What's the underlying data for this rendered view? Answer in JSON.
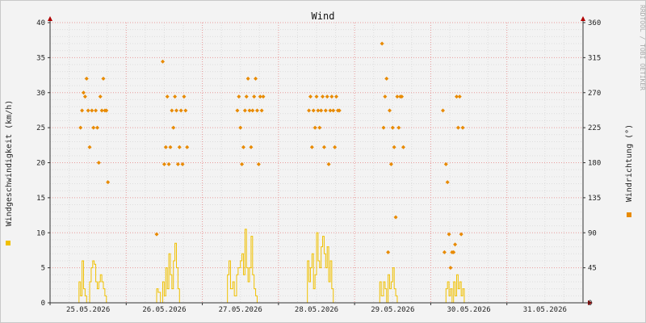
{
  "chart_data": {
    "type": "scatter",
    "title": "Wind",
    "ylabel": "Windgeschwindigkeit (km/h)",
    "y2label": "Windrichtung (°)",
    "watermark": "RRDTOOL / TOBI OETIKER",
    "xticks": [
      "25.05.2026",
      "26.05.2026",
      "27.05.2026",
      "28.05.2026",
      "29.05.2026",
      "30.05.2026",
      "31.05.2026"
    ],
    "yticks": [
      0,
      5,
      10,
      15,
      20,
      25,
      30,
      35,
      40
    ],
    "y2ticks": [
      0,
      45,
      90,
      135,
      180,
      225,
      270,
      315,
      360
    ],
    "ylim": [
      0,
      40
    ],
    "y2lim": [
      0,
      360
    ],
    "xlim_days": [
      0,
      7
    ],
    "grid": true,
    "colors": {
      "speed": "#f0c000",
      "direction": "#e88a00",
      "grid_major": "#e89a9a",
      "grid_minor": "#dddddd",
      "axis": "#b00000"
    },
    "series": [
      {
        "name": "",
        "type": "line",
        "points": [
          [
            0.36,
            0
          ],
          [
            0.38,
            3
          ],
          [
            0.4,
            1
          ],
          [
            0.42,
            6
          ],
          [
            0.44,
            2
          ],
          [
            0.46,
            1
          ],
          [
            0.48,
            0
          ],
          [
            0.52,
            3
          ],
          [
            0.54,
            5
          ],
          [
            0.56,
            6
          ],
          [
            0.58,
            5.5
          ],
          [
            0.6,
            3
          ],
          [
            0.62,
            2
          ],
          [
            0.64,
            3
          ],
          [
            0.66,
            4
          ],
          [
            0.68,
            3
          ],
          [
            0.7,
            2
          ],
          [
            0.72,
            1
          ],
          [
            0.74,
            0
          ],
          [
            1.36,
            0
          ],
          [
            1.4,
            2
          ],
          [
            1.42,
            1.5
          ],
          [
            1.45,
            0
          ],
          [
            1.48,
            3
          ],
          [
            1.5,
            1
          ],
          [
            1.52,
            5
          ],
          [
            1.54,
            2
          ],
          [
            1.56,
            7
          ],
          [
            1.58,
            4
          ],
          [
            1.6,
            2
          ],
          [
            1.62,
            6
          ],
          [
            1.64,
            8.5
          ],
          [
            1.66,
            5
          ],
          [
            1.68,
            2
          ],
          [
            1.7,
            0
          ],
          [
            2.3,
            0
          ],
          [
            2.33,
            4
          ],
          [
            2.35,
            6
          ],
          [
            2.37,
            2
          ],
          [
            2.4,
            3
          ],
          [
            2.42,
            1
          ],
          [
            2.45,
            4
          ],
          [
            2.47,
            5
          ],
          [
            2.5,
            6
          ],
          [
            2.52,
            7
          ],
          [
            2.54,
            4
          ],
          [
            2.56,
            10.5
          ],
          [
            2.58,
            5
          ],
          [
            2.6,
            3
          ],
          [
            2.62,
            5
          ],
          [
            2.64,
            9.5
          ],
          [
            2.66,
            4
          ],
          [
            2.68,
            2
          ],
          [
            2.7,
            1
          ],
          [
            2.72,
            0
          ],
          [
            3.36,
            0
          ],
          [
            3.38,
            6
          ],
          [
            3.4,
            3
          ],
          [
            3.42,
            5
          ],
          [
            3.44,
            7
          ],
          [
            3.46,
            2
          ],
          [
            3.48,
            4
          ],
          [
            3.5,
            10
          ],
          [
            3.52,
            6
          ],
          [
            3.54,
            5
          ],
          [
            3.56,
            8
          ],
          [
            3.58,
            9.5
          ],
          [
            3.6,
            7
          ],
          [
            3.62,
            5
          ],
          [
            3.64,
            8
          ],
          [
            3.66,
            3
          ],
          [
            3.68,
            6
          ],
          [
            3.7,
            2
          ],
          [
            3.72,
            0
          ],
          [
            4.3,
            0
          ],
          [
            4.33,
            3
          ],
          [
            4.35,
            1
          ],
          [
            4.38,
            3
          ],
          [
            4.4,
            2
          ],
          [
            4.42,
            0
          ],
          [
            4.44,
            4
          ],
          [
            4.46,
            2
          ],
          [
            4.48,
            3
          ],
          [
            4.5,
            5
          ],
          [
            4.52,
            2
          ],
          [
            4.54,
            1
          ],
          [
            4.56,
            0
          ],
          [
            5.18,
            0
          ],
          [
            5.2,
            2
          ],
          [
            5.22,
            3
          ],
          [
            5.24,
            1
          ],
          [
            5.26,
            2
          ],
          [
            5.28,
            0
          ],
          [
            5.3,
            3
          ],
          [
            5.32,
            1
          ],
          [
            5.34,
            4
          ],
          [
            5.36,
            2
          ],
          [
            5.38,
            3
          ],
          [
            5.4,
            1
          ],
          [
            5.42,
            2
          ],
          [
            5.44,
            0
          ]
        ]
      },
      {
        "name": "",
        "type": "scatter",
        "points": [
          [
            0.4,
            225
          ],
          [
            0.42,
            247
          ],
          [
            0.44,
            270
          ],
          [
            0.46,
            265
          ],
          [
            0.48,
            288
          ],
          [
            0.5,
            247
          ],
          [
            0.52,
            200
          ],
          [
            0.55,
            247
          ],
          [
            0.57,
            225
          ],
          [
            0.6,
            247
          ],
          [
            0.62,
            225
          ],
          [
            0.64,
            180
          ],
          [
            0.66,
            265
          ],
          [
            0.68,
            247
          ],
          [
            0.7,
            288
          ],
          [
            0.72,
            247
          ],
          [
            0.74,
            247
          ],
          [
            0.76,
            155
          ],
          [
            1.4,
            88
          ],
          [
            1.48,
            310
          ],
          [
            1.5,
            178
          ],
          [
            1.52,
            200
          ],
          [
            1.54,
            265
          ],
          [
            1.56,
            178
          ],
          [
            1.58,
            200
          ],
          [
            1.6,
            247
          ],
          [
            1.62,
            225
          ],
          [
            1.64,
            265
          ],
          [
            1.66,
            247
          ],
          [
            1.68,
            178
          ],
          [
            1.7,
            200
          ],
          [
            1.72,
            247
          ],
          [
            1.74,
            178
          ],
          [
            1.76,
            265
          ],
          [
            1.78,
            247
          ],
          [
            1.8,
            200
          ],
          [
            2.46,
            247
          ],
          [
            2.48,
            265
          ],
          [
            2.5,
            225
          ],
          [
            2.52,
            178
          ],
          [
            2.54,
            200
          ],
          [
            2.56,
            247
          ],
          [
            2.58,
            265
          ],
          [
            2.6,
            288
          ],
          [
            2.62,
            247
          ],
          [
            2.64,
            200
          ],
          [
            2.66,
            247
          ],
          [
            2.68,
            265
          ],
          [
            2.7,
            288
          ],
          [
            2.72,
            247
          ],
          [
            2.74,
            178
          ],
          [
            2.76,
            265
          ],
          [
            2.78,
            247
          ],
          [
            2.8,
            265
          ],
          [
            3.4,
            247
          ],
          [
            3.42,
            265
          ],
          [
            3.44,
            200
          ],
          [
            3.46,
            247
          ],
          [
            3.48,
            225
          ],
          [
            3.5,
            265
          ],
          [
            3.52,
            247
          ],
          [
            3.54,
            225
          ],
          [
            3.56,
            247
          ],
          [
            3.58,
            265
          ],
          [
            3.6,
            200
          ],
          [
            3.62,
            247
          ],
          [
            3.64,
            265
          ],
          [
            3.66,
            178
          ],
          [
            3.68,
            247
          ],
          [
            3.7,
            265
          ],
          [
            3.72,
            247
          ],
          [
            3.74,
            200
          ],
          [
            3.76,
            265
          ],
          [
            3.78,
            247
          ],
          [
            3.8,
            247
          ],
          [
            4.36,
            333
          ],
          [
            4.38,
            225
          ],
          [
            4.4,
            265
          ],
          [
            4.42,
            288
          ],
          [
            4.44,
            65
          ],
          [
            4.46,
            247
          ],
          [
            4.48,
            178
          ],
          [
            4.5,
            225
          ],
          [
            4.52,
            200
          ],
          [
            4.54,
            110
          ],
          [
            4.56,
            265
          ],
          [
            4.58,
            225
          ],
          [
            4.6,
            265
          ],
          [
            4.62,
            265
          ],
          [
            4.64,
            200
          ],
          [
            5.16,
            247
          ],
          [
            5.18,
            65
          ],
          [
            5.2,
            178
          ],
          [
            5.22,
            155
          ],
          [
            5.24,
            88
          ],
          [
            5.26,
            45
          ],
          [
            5.28,
            65
          ],
          [
            5.3,
            65
          ],
          [
            5.32,
            75
          ],
          [
            5.34,
            265
          ],
          [
            5.36,
            225
          ],
          [
            5.38,
            265
          ],
          [
            5.4,
            88
          ],
          [
            5.42,
            225
          ]
        ]
      }
    ]
  }
}
